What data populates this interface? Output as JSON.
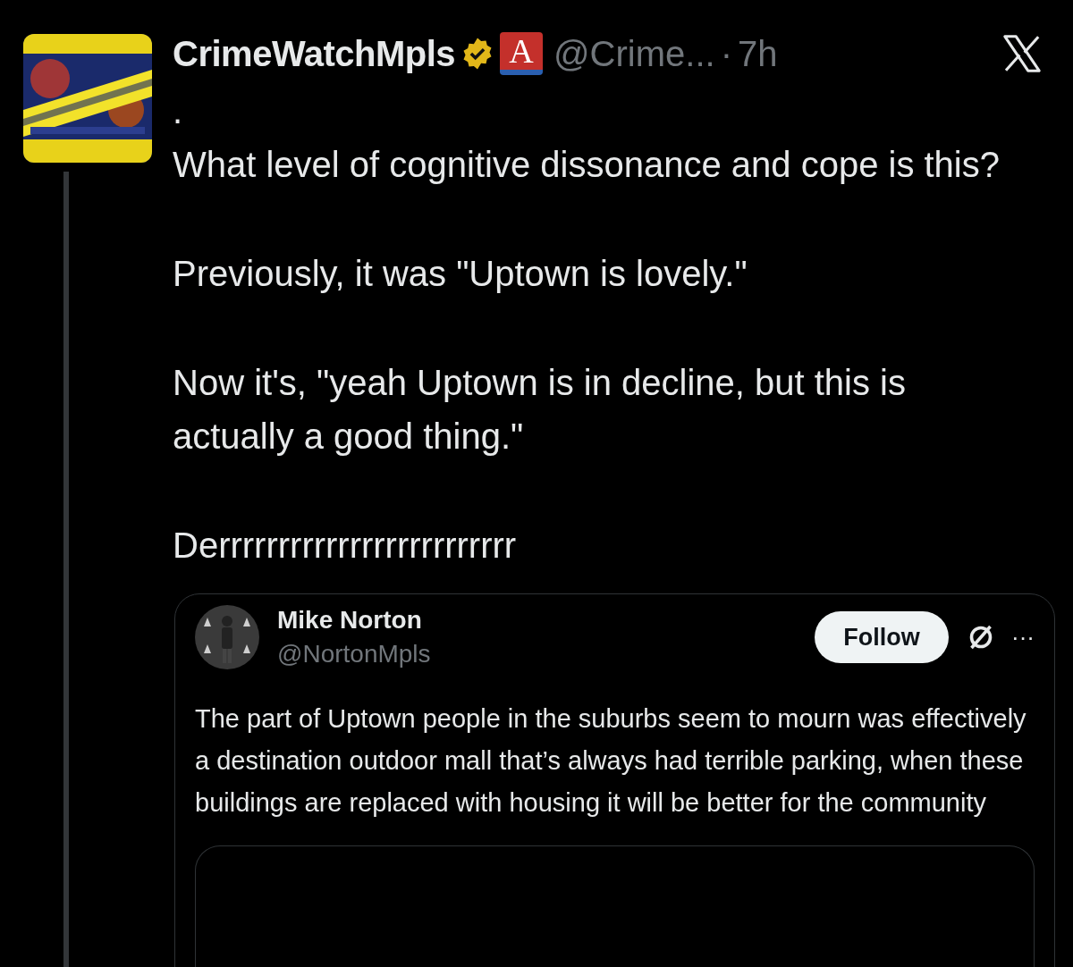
{
  "post": {
    "author": {
      "name": "CrimeWatchMpls",
      "verified": true,
      "affiliate_badge": "A",
      "handle": "@Crime...",
      "separator": "·",
      "time": "7h"
    },
    "body": [
      [
        ".",
        "What level of cognitive dissonance and cope is this?"
      ],
      [
        "Previously, it was \"Uptown is lovely.\""
      ],
      [
        "Now it's, \"yeah Uptown is in decline, but this is actually a good thing.\""
      ],
      [
        "Derrrrrrrrrrrrrrrrrrrrrrrrr"
      ]
    ],
    "quote": {
      "name": "Mike Norton",
      "handle": "@NortonMpls",
      "follow_button": "Follow",
      "more": "···",
      "text": "The part of Uptown people in the suburbs seem to mourn was effectively a destination outdoor mall that’s always had terrible parking, when these buildings are replaced with housing it will be better for the community"
    }
  }
}
